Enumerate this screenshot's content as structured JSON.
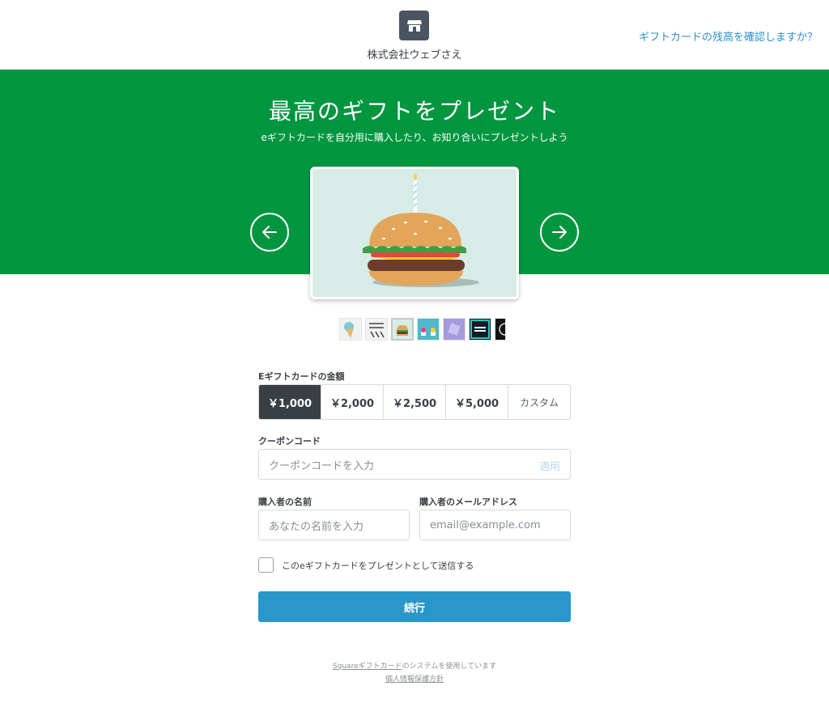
{
  "header": {
    "store_name": "株式会社ウェブさえ",
    "store_icon": "storefront-icon",
    "balance_link": "ギフトカードの残高を確認しますか？"
  },
  "hero": {
    "title": "最高のギフトをプレゼント",
    "subtitle": "eギフトカードを自分用に購入したり、お知り合いにプレゼントしよう",
    "bg_color": "#00963f"
  },
  "carousel": {
    "prev_icon": "arrow-left-icon",
    "next_icon": "arrow-right-icon",
    "selected_design": "burger-birthday",
    "thumbnails": [
      "ice-cream",
      "birthday-text",
      "burger-birthday",
      "cupcakes",
      "purple-pattern",
      "happy-birthday-teal",
      "dark"
    ]
  },
  "form": {
    "amount_label": "Eギフトカードの金額",
    "amounts": [
      "￥1,000",
      "￥2,000",
      "￥2,500",
      "￥5,000",
      "カスタム"
    ],
    "selected_amount": "￥1,000",
    "coupon_label": "クーポンコード",
    "coupon_placeholder": "クーポンコードを入力",
    "coupon_apply": "適用",
    "name_label": "購入者の名前",
    "name_placeholder": "あなたの名前を入力",
    "email_label": "購入者のメールアドレス",
    "email_placeholder": "email@example.com",
    "gift_checkbox_label": "このeギフトカードをプレゼントとして送信する",
    "continue_label": "続行",
    "accent_color": "#2996cc"
  },
  "footer": {
    "square_link": "Squareギフトカード",
    "powered_text": "のシステムを使用しています",
    "privacy_link": "個人情報保護方針"
  }
}
